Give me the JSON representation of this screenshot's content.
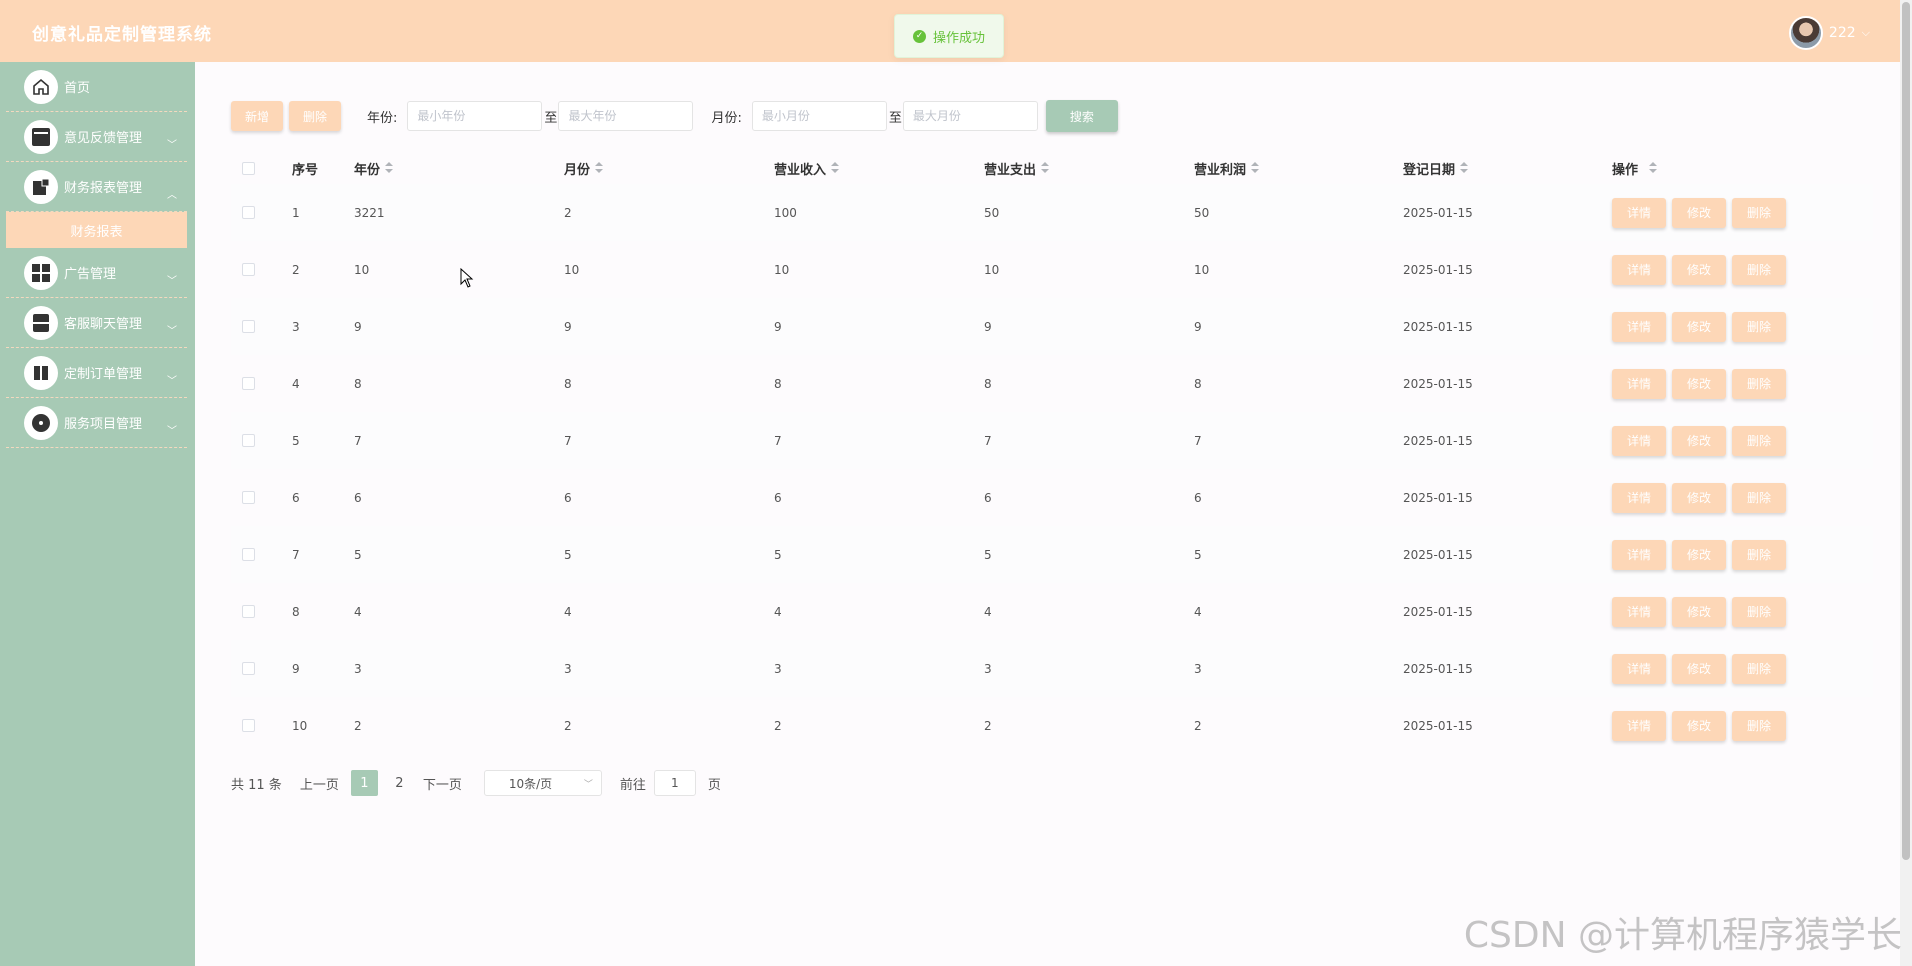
{
  "app": {
    "title": "创意礼品定制管理系统",
    "username": "222"
  },
  "toast": {
    "message": "操作成功"
  },
  "sidebar": {
    "items": [
      {
        "label": "首页",
        "icon": "home-icon"
      },
      {
        "label": "意见反馈管理",
        "icon": "box-icon"
      },
      {
        "label": "财务报表管理",
        "icon": "document-icon"
      },
      {
        "label": "广告管理",
        "icon": "grid-icon"
      },
      {
        "label": "客服聊天管理",
        "icon": "cabinet-icon"
      },
      {
        "label": "定制订单管理",
        "icon": "book-icon"
      },
      {
        "label": "服务项目管理",
        "icon": "disc-icon"
      }
    ],
    "submenu_active": "财务报表"
  },
  "toolbar": {
    "add_label": "新增",
    "delete_label": "删除",
    "year_label": "年份:",
    "year_min_placeholder": "最小年份",
    "to1": "至",
    "year_max_placeholder": "最大年份",
    "month_label": "月份:",
    "month_min_placeholder": "最小月份",
    "to2": "至",
    "month_max_placeholder": "最大月份",
    "search_label": "搜索"
  },
  "table": {
    "headers": [
      "序号",
      "年份",
      "月份",
      "营业收入",
      "营业支出",
      "营业利润",
      "登记日期",
      "操作"
    ],
    "ops": {
      "detail": "详情",
      "edit": "修改",
      "delete": "删除"
    },
    "rows": [
      {
        "num": "1",
        "year": "3221",
        "month": "2",
        "income": "100",
        "expense": "50",
        "profit": "50",
        "date": "2025-01-15"
      },
      {
        "num": "2",
        "year": "10",
        "month": "10",
        "income": "10",
        "expense": "10",
        "profit": "10",
        "date": "2025-01-15"
      },
      {
        "num": "3",
        "year": "9",
        "month": "9",
        "income": "9",
        "expense": "9",
        "profit": "9",
        "date": "2025-01-15"
      },
      {
        "num": "4",
        "year": "8",
        "month": "8",
        "income": "8",
        "expense": "8",
        "profit": "8",
        "date": "2025-01-15"
      },
      {
        "num": "5",
        "year": "7",
        "month": "7",
        "income": "7",
        "expense": "7",
        "profit": "7",
        "date": "2025-01-15"
      },
      {
        "num": "6",
        "year": "6",
        "month": "6",
        "income": "6",
        "expense": "6",
        "profit": "6",
        "date": "2025-01-15"
      },
      {
        "num": "7",
        "year": "5",
        "month": "5",
        "income": "5",
        "expense": "5",
        "profit": "5",
        "date": "2025-01-15"
      },
      {
        "num": "8",
        "year": "4",
        "month": "4",
        "income": "4",
        "expense": "4",
        "profit": "4",
        "date": "2025-01-15"
      },
      {
        "num": "9",
        "year": "3",
        "month": "3",
        "income": "3",
        "expense": "3",
        "profit": "3",
        "date": "2025-01-15"
      },
      {
        "num": "10",
        "year": "2",
        "month": "2",
        "income": "2",
        "expense": "2",
        "profit": "2",
        "date": "2025-01-15"
      }
    ]
  },
  "pagination": {
    "total": "共 11 条",
    "prev": "上一页",
    "pages": [
      "1",
      "2"
    ],
    "next": "下一页",
    "page_size": "10条/页",
    "goto_label": "前往",
    "goto_value": "1",
    "page_suffix": "页"
  },
  "watermark": "CSDN @计算机程序猿学长"
}
